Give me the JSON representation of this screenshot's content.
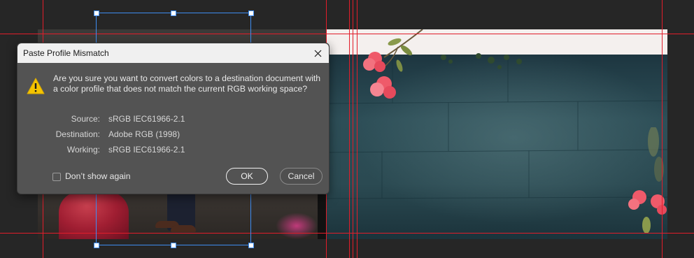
{
  "dialog": {
    "title": "Paste Profile Mismatch",
    "message": "Are you sure you want to convert colors to a destination document with a color profile that does not match the current RGB working space?",
    "source_label": "Source:",
    "source_value": "sRGB IEC61966-2.1",
    "destination_label": "Destination:",
    "destination_value": "Adobe RGB (1998)",
    "working_label": "Working:",
    "working_value": "sRGB IEC61966-2.1",
    "checkbox_label": "Don’t show again",
    "checkbox_checked": false,
    "ok_label": "OK",
    "cancel_label": "Cancel"
  },
  "icons": {
    "warning": "warning-triangle-icon",
    "close": "close-icon"
  },
  "colors": {
    "guide": "#e21d2a",
    "selection": "#3f8df2",
    "warning_fill": "#f5c400",
    "dialog_bg": "#535353",
    "workspace_bg": "#262626"
  }
}
